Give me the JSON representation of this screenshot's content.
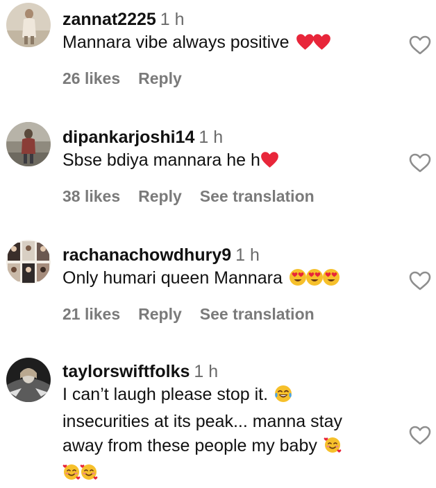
{
  "comments": [
    {
      "username": "zannat2225",
      "time": "1 h",
      "text": "Mannara vibe always positive",
      "emojis": [
        "red-heart",
        "red-heart"
      ],
      "likes": "26 likes",
      "reply": "Reply"
    },
    {
      "username": "dipankarjoshi14",
      "time": "1 h",
      "text": "Sbse bdiya mannara he h",
      "emojis": [
        "red-heart"
      ],
      "likes": "38 likes",
      "reply": "Reply",
      "translate": "See translation"
    },
    {
      "username": "rachanachowdhury9",
      "time": "1 h",
      "text": "Only humari queen Mannara",
      "emojis": [
        "heart-eyes",
        "heart-eyes",
        "heart-eyes"
      ],
      "likes": "21 likes",
      "reply": "Reply",
      "translate": "See translation"
    },
    {
      "username": "taylorswiftfolks",
      "time": "1 h",
      "text_line1": "I can’t laugh please stop it.",
      "text_line2": "insecurities at its peak... manna stay",
      "text_line3": "away from these people my baby",
      "emojis": [
        "tears-of-joy",
        "smiling-hearts",
        "smiling-hearts",
        "smiling-hearts"
      ]
    }
  ],
  "colors": {
    "text": "#111111",
    "muted": "#7a7a7a",
    "heart_outline": "#8e8e8e",
    "red_heart": "#e8263a",
    "emoji_yellow": "#f6c02b"
  }
}
